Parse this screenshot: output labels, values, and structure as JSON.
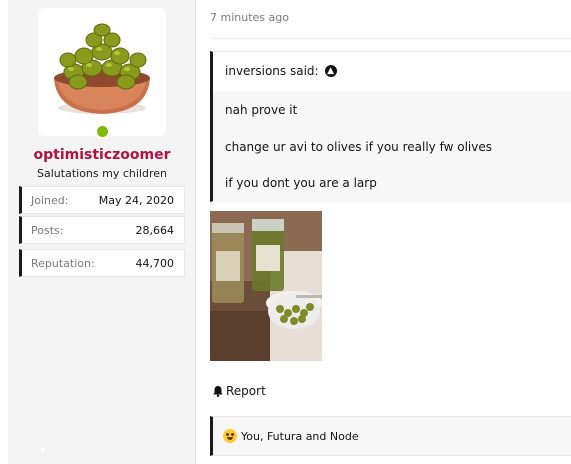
{
  "user": {
    "username": "optimisticzoomer",
    "title": "Salutations my children",
    "online": true,
    "stats": [
      {
        "key": "Joined:",
        "value": "May 24, 2020"
      },
      {
        "key": "Posts:",
        "value": "28,664"
      },
      {
        "key": "Reputation:",
        "value": "44,700"
      }
    ]
  },
  "message": {
    "timestamp": "7 minutes ago",
    "quote": {
      "author_line": "inversions said:",
      "lines": [
        "nah prove it",
        "change ur avi to olives if you really fw olives",
        "if you dont you are a larp"
      ]
    },
    "report_label": "Report",
    "reactions_text": "You, Futura and Node"
  },
  "colors": {
    "username": "#b3123f",
    "online": "#7fba00"
  }
}
